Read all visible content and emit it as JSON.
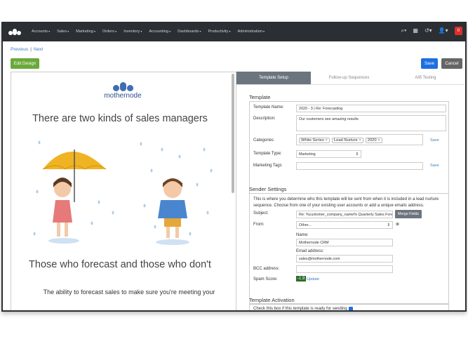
{
  "nav": {
    "items": [
      "Accounts",
      "Sales",
      "Marketing",
      "Orders",
      "Inventory",
      "Accounting",
      "Dashboards",
      "Productivity",
      "Administration"
    ],
    "badge": "0"
  },
  "breadcrumb": {
    "previous": "Previous",
    "separator": "|",
    "next": "Next"
  },
  "toolbar": {
    "edit_label": "Edit Design",
    "save_label": "Save",
    "cancel_label": "Cancel"
  },
  "preview": {
    "brand": "mothernode",
    "headline": "There are two kinds of sales managers",
    "subhead": "Those who forecast and those who don't",
    "body": "The ability to forecast sales to make sure you're meeting your"
  },
  "tabs": [
    {
      "label": "Template Setup"
    },
    {
      "label": "Follow-up Sequences"
    },
    {
      "label": "A/B Testing"
    }
  ],
  "template": {
    "heading": "Template",
    "name_label": "Template Name:",
    "name_value": "2020 - 3 | Re: Forecasting",
    "desc_label": "Description:",
    "desc_value": "Our customers see amazing results",
    "cat_label": "Categories",
    "categories": [
      "White Series",
      "Lead Nurture",
      "2020"
    ],
    "cat_save": "Save",
    "type_label": "Template Type:",
    "type_value": "Marketing",
    "tags_label": "Marketing Tags",
    "tags_save": "Save"
  },
  "sender": {
    "heading": "Sender Settings",
    "note": "This is where you determine who this template will be sent from when it is included in a lead nurture sequence. Choose from one of your existing user accounts or add a unique emails address.",
    "subject_label": "Subject:",
    "subject_value": "Re: %customer_company_name% Quarterly Sales Forec",
    "merge_label": "Merge Fields",
    "from_label": "From:",
    "from_value": "Other...",
    "name_label": "Name:",
    "name_value": "Mothernode CRM",
    "email_label": "Email address:",
    "email_value": "sales@mothernode.com",
    "bcc_label": "BCC address:",
    "spam_label": "Spam Score:",
    "spam_value": "-1.9",
    "update_label": "Update"
  },
  "activation": {
    "heading": "Template Activation",
    "note": "Check this box if this template is ready for sending"
  },
  "colors": {
    "topbar": "#2b2f33",
    "edit": "#6aa93a",
    "save": "#1e6fe0",
    "cancel": "#666666",
    "brand": "#3f6fb3"
  }
}
